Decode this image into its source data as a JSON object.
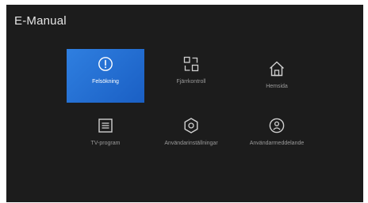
{
  "header": {
    "title": "E-Manual"
  },
  "menu": {
    "items": [
      {
        "label": "Felsökning",
        "icon": "alert-circle-icon"
      },
      {
        "label": "Fjärrkontroll",
        "icon": "remote-grid-icon"
      },
      {
        "label": "Hemsida",
        "icon": "home-icon"
      },
      {
        "label": "TV-program",
        "icon": "tv-guide-icon"
      },
      {
        "label": "Användarinställningar",
        "icon": "hexagon-settings-icon"
      },
      {
        "label": "Användarmeddelande",
        "icon": "user-circle-icon"
      }
    ],
    "selected_index": 0
  },
  "colors": {
    "background": "#1c1c1c",
    "accent": "#1f6fd6",
    "label": "#9a9a9a"
  }
}
